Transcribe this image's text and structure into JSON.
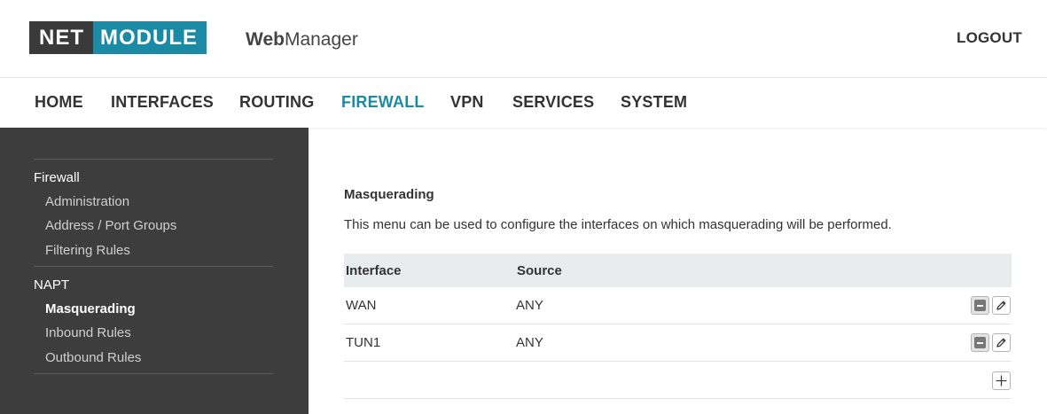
{
  "header": {
    "logo_left": "NET",
    "logo_right": "MODULE",
    "app_name_bold": "Web",
    "app_name_rest": "Manager",
    "logout_label": "LOGOUT"
  },
  "nav": {
    "items": [
      "HOME",
      "INTERFACES",
      "ROUTING",
      "FIREWALL",
      "VPN",
      "SERVICES",
      "SYSTEM"
    ],
    "active": "FIREWALL"
  },
  "sidebar": {
    "groups": [
      {
        "label": "Firewall",
        "items": [
          "Administration",
          "Address / Port Groups",
          "Filtering Rules"
        ]
      },
      {
        "label": "NAPT",
        "items": [
          "Masquerading",
          "Inbound Rules",
          "Outbound Rules"
        ]
      }
    ],
    "active_item": "Masquerading"
  },
  "main": {
    "title": "Masquerading",
    "description": "This menu can be used to configure the interfaces on which masquerading will be performed.",
    "table": {
      "headers": [
        "Interface",
        "Source"
      ],
      "rows": [
        {
          "interface": "WAN",
          "source": "ANY"
        },
        {
          "interface": "TUN1",
          "source": "ANY"
        }
      ]
    }
  },
  "colors": {
    "accent": "#1b8ba5",
    "logo_dark": "#3a3a3a",
    "sidebar_bg": "#3d3d3d",
    "table_header_bg": "#e8ecec"
  },
  "icons": {
    "remove": "minus-square-icon",
    "edit": "pencil-icon",
    "add": "plus-icon"
  }
}
